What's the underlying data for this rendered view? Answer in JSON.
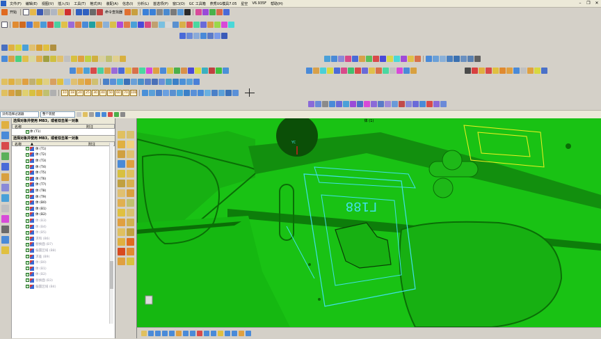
{
  "menu": {
    "start_label": "开始",
    "items": [
      "文件(F)",
      "编辑(E)",
      "视图(V)",
      "插入(S)",
      "工具(T)",
      "格式(R)",
      "装配(A)",
      "信息(I)",
      "分析(L)",
      "首选项(P)",
      "窗口(O)",
      "GC 工具箱",
      "燕秀UG模具7.05",
      "星空",
      "V6.935F",
      "帮助(H)"
    ],
    "command_finder": "命令查找器"
  },
  "labels_row": [
    "10",
    "18",
    "20",
    "25",
    "30",
    "40",
    "50",
    "60",
    "70",
    "100"
  ],
  "filter": {
    "type_filter": "没有选择过滤器",
    "assembly_filter": "整个装配"
  },
  "navigator": {
    "hint_top": "选择对象并使用 MB3，或者双击某一对象",
    "hint_mid": "选择对象并使用 MB3，或者双击某一对象",
    "col_name": "名称",
    "col_owner": "附注",
    "sort_marker": "▲",
    "top_item": "体 (T1)",
    "items": [
      {
        "label": "体 (T1)",
        "dim": false
      },
      {
        "label": "体 (T2)",
        "dim": false
      },
      {
        "label": "体 (T3)",
        "dim": false
      },
      {
        "label": "体 (T4)",
        "dim": false
      },
      {
        "label": "体 (T5)",
        "dim": false
      },
      {
        "label": "体 (T6)",
        "dim": false
      },
      {
        "label": "体 (T7)",
        "dim": false
      },
      {
        "label": "体 (T8)",
        "dim": false
      },
      {
        "label": "体 (T9)",
        "dim": false
      },
      {
        "label": "体 (B0)",
        "dim": false
      },
      {
        "label": "体 (B1)",
        "dim": false
      },
      {
        "label": "体 (B2)",
        "dim": false
      },
      {
        "label": "体 (B3)",
        "dim": true
      },
      {
        "label": "体 (B4)",
        "dim": true
      },
      {
        "label": "体 (B5)",
        "dim": true
      },
      {
        "label": "求和 (B6)",
        "dim": true
      },
      {
        "label": "替换面 (B7)",
        "dim": true
      },
      {
        "label": "偏置区域 (B8)",
        "dim": true
      },
      {
        "label": "求差 (B9)",
        "dim": true
      },
      {
        "label": "体 (B0)",
        "dim": true
      },
      {
        "label": "体 (B1)",
        "dim": true
      },
      {
        "label": "体 (B2)",
        "dim": true
      },
      {
        "label": "替换面 (B3)",
        "dim": true
      },
      {
        "label": "偏置区域 (B4)",
        "dim": true
      }
    ]
  },
  "viewport": {
    "title": "体 (1)",
    "part_text": "Г188",
    "axis_label": "YC"
  },
  "colors": {
    "viewport_bg": "#19c214",
    "model_edge": "#0a6e06",
    "selection": "#40e0e8",
    "highlight": "#f0f020"
  }
}
